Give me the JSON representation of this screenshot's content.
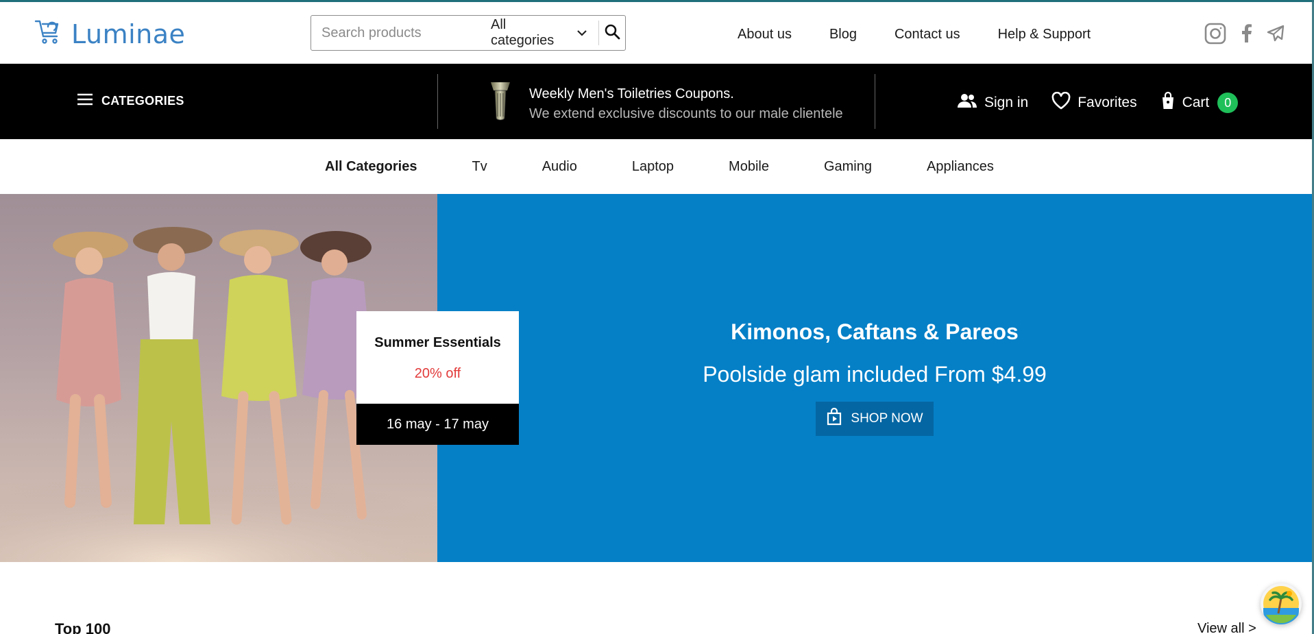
{
  "brand": {
    "name": "Luminae"
  },
  "search": {
    "placeholder": "Search products",
    "category": "All categories"
  },
  "top_links": [
    "About us",
    "Blog",
    "Contact us",
    "Help & Support"
  ],
  "social_icons": [
    "instagram-icon",
    "facebook-icon",
    "telegram-icon"
  ],
  "bar": {
    "categories_label": "CATEGORIES",
    "promo_title": "Weekly Men's Toiletries Coupons.",
    "promo_sub": "We extend exclusive discounts to our male clientele",
    "sign_in": "Sign in",
    "favorites": "Favorites",
    "cart": "Cart",
    "cart_count": "0"
  },
  "category_nav": [
    "All Categories",
    "Tv",
    "Audio",
    "Laptop",
    "Mobile",
    "Gaming",
    "Appliances"
  ],
  "hero": {
    "title": "Kimonos, Caftans & Pareos",
    "subtitle": "Poolside glam included From $4.99",
    "cta": "SHOP NOW",
    "card_title": "Summer Essentials",
    "card_discount": "20% off",
    "card_dates": "16 may - 17 may"
  },
  "section": {
    "title": "Top 100",
    "view_all": "View all >"
  },
  "colors": {
    "brand_blue": "#3b82c4",
    "hero_blue": "#0580c7",
    "cart_badge": "#1fbf5a",
    "discount_red": "#e23a3a"
  }
}
